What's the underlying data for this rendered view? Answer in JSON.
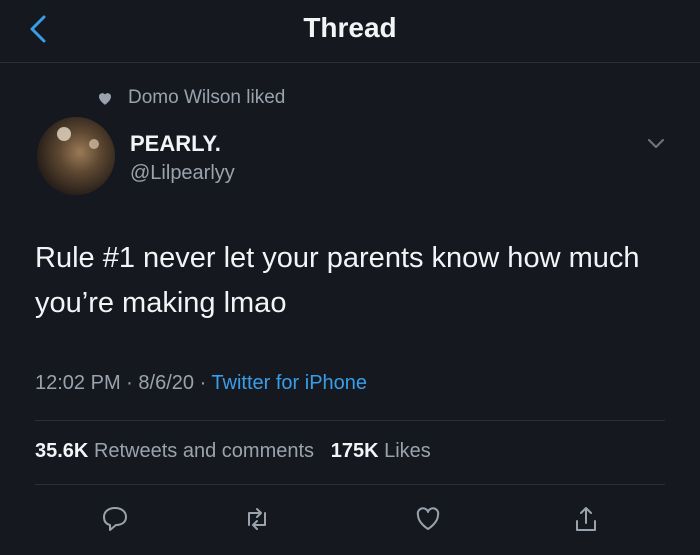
{
  "header": {
    "title": "Thread"
  },
  "social_context": {
    "text": "Domo Wilson liked"
  },
  "author": {
    "name": "PEARLY.",
    "handle": "@Lilpearlyy"
  },
  "tweet": {
    "text": "Rule #1 never let your parents know how much you’re making lmao",
    "time": "12:02 PM",
    "date": "8/6/20",
    "source": "Twitter for iPhone"
  },
  "stats": {
    "retweets_count": "35.6K",
    "retweets_label": "Retweets and comments",
    "likes_count": "175K",
    "likes_label": "Likes"
  },
  "colors": {
    "background": "#15181f",
    "accent": "#3a9de8",
    "muted": "#9aa3ad"
  },
  "icons": [
    "back-icon",
    "heart-icon",
    "chevron-down-icon",
    "reply-icon",
    "retweet-icon",
    "like-icon",
    "share-icon"
  ]
}
